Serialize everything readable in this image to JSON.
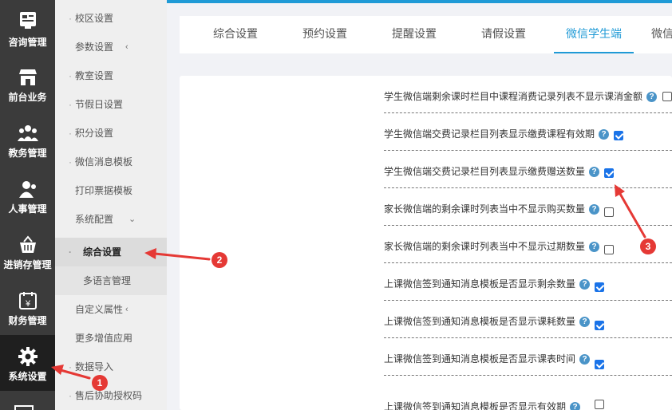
{
  "left_nav": [
    {
      "label": "咨询管理",
      "icon": "consult-icon"
    },
    {
      "label": "前台业务",
      "icon": "storefront-icon"
    },
    {
      "label": "教务管理",
      "icon": "people-icon"
    },
    {
      "label": "人事管理",
      "icon": "person-icon"
    },
    {
      "label": "进销存管理",
      "icon": "basket-icon"
    },
    {
      "label": "财务管理",
      "icon": "calendar-money-icon"
    },
    {
      "label": "系统设置",
      "icon": "gear-icon"
    }
  ],
  "sub_nav": [
    {
      "label": "校区设置",
      "arrow": ""
    },
    {
      "label": "参数设置",
      "arrow": "‹"
    },
    {
      "label": "教室设置",
      "arrow": ""
    },
    {
      "label": "节假日设置",
      "arrow": ""
    },
    {
      "label": "积分设置",
      "arrow": ""
    },
    {
      "label": "微信消息模板",
      "arrow": ""
    },
    {
      "label": "打印票据模板",
      "arrow": "‹"
    },
    {
      "label": "系统配置",
      "arrow": "⌄"
    },
    {
      "label": "综合设置",
      "arrow": ""
    },
    {
      "label": "多语言管理",
      "arrow": ""
    },
    {
      "label": "自定义属性",
      "arrow": "‹"
    },
    {
      "label": "更多增值应用",
      "arrow": "‹"
    },
    {
      "label": "数据导入",
      "arrow": ""
    },
    {
      "label": "售后协助授权码",
      "arrow": ""
    }
  ],
  "tabs": [
    "综合设置",
    "预约设置",
    "提醒设置",
    "请假设置",
    "微信学生端",
    "微信"
  ],
  "active_tab": "微信学生端",
  "settings": [
    {
      "label": "学生微信端剩余课时栏目中课程消费记录列表不显示课消金额",
      "checked": false
    },
    {
      "label": "学生微信端交费记录栏目列表显示缴费课程有效期",
      "checked": true
    },
    {
      "label": "学生微信端交费记录栏目列表显示缴费赠送数量",
      "checked": true
    },
    {
      "label": "家长微信端的剩余课时列表当中不显示购买数量",
      "checked": false
    },
    {
      "label": "家长微信端的剩余课时列表当中不显示过期数量",
      "checked": false
    },
    {
      "label": "上课微信签到通知消息模板是否显示剩余数量",
      "checked": true
    },
    {
      "label": "上课微信签到通知消息模板是否显示课耗数量",
      "checked": true
    },
    {
      "label": "上课微信签到通知消息模板是否显示课表时间",
      "checked": true
    },
    {
      "label": "上课微信签到通知消息模板是否显示有效期",
      "checked": false
    }
  ],
  "help_glyph": "?",
  "annotations": {
    "badge_1": "1",
    "badge_2": "2",
    "badge_3": "3"
  },
  "colors": {
    "accent": "#1f9ad6",
    "annotation": "#e53935",
    "checkbox": "#1a73e8"
  }
}
